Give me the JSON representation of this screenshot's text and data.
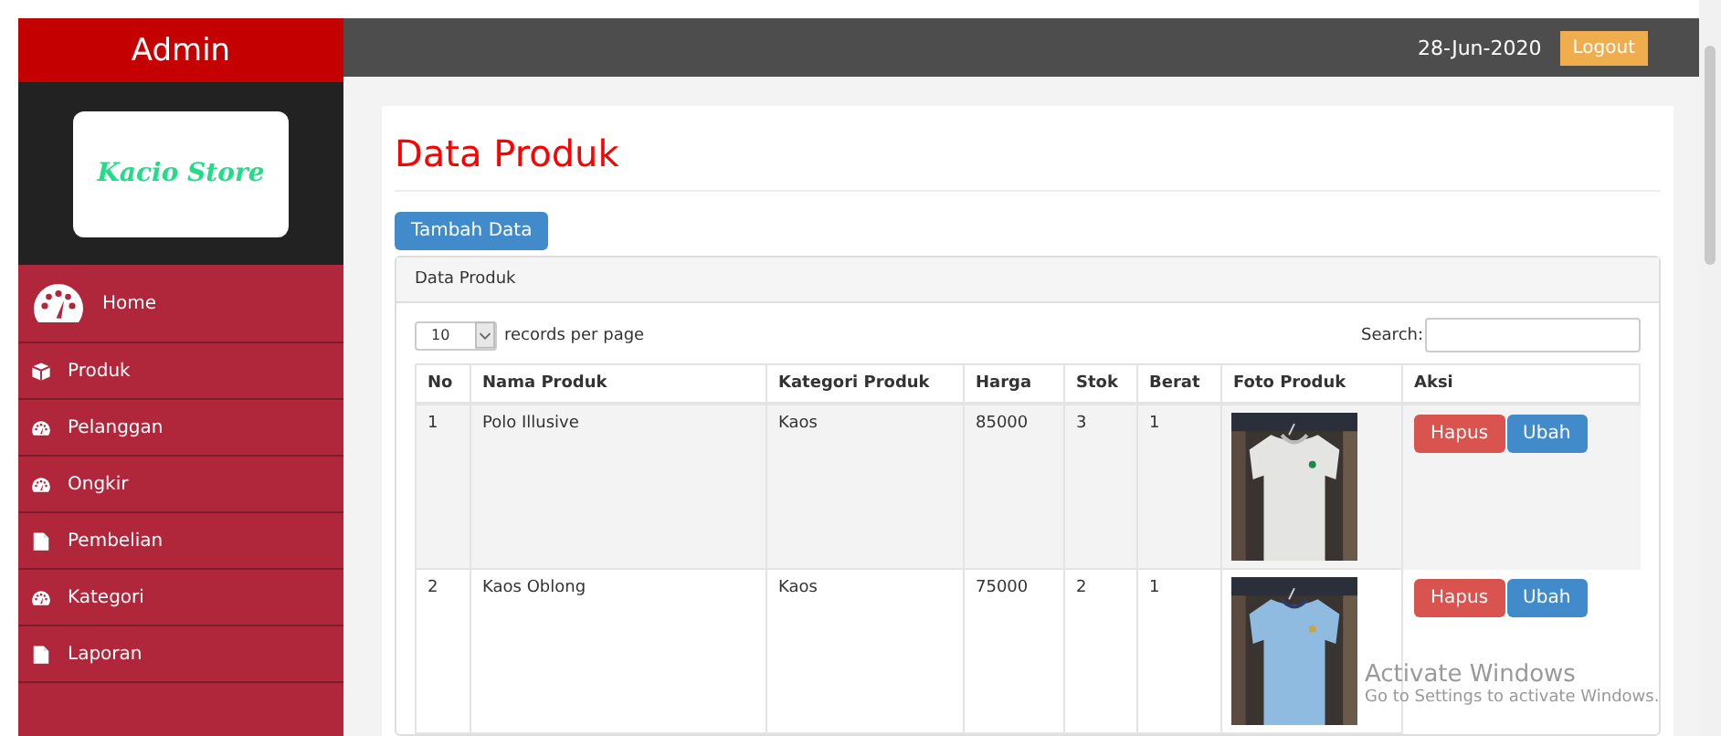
{
  "sidebar": {
    "title": "Admin",
    "logo": "Kacio Store",
    "items": [
      {
        "label": "Home",
        "kind": "gauge"
      },
      {
        "label": "Produk",
        "kind": "cube"
      },
      {
        "label": "Pelanggan",
        "kind": "gauge"
      },
      {
        "label": "Ongkir",
        "kind": "gauge"
      },
      {
        "label": "Pembelian",
        "kind": "file"
      },
      {
        "label": "Kategori",
        "kind": "gauge"
      },
      {
        "label": "Laporan",
        "kind": "file"
      }
    ]
  },
  "topbar": {
    "date": "28-Jun-2020",
    "logout": "Logout"
  },
  "page": {
    "title": "Data Produk",
    "add_button": "Tambah Data"
  },
  "panel": {
    "heading": "Data Produk",
    "page_size": "10",
    "page_size_label": "records per page",
    "search_label": "Search:",
    "columns": [
      "No",
      "Nama Produk",
      "Kategori Produk",
      "Harga",
      "Stok",
      "Berat",
      "Foto Produk",
      "Aksi"
    ],
    "rows": [
      {
        "no": "1",
        "name": "Polo Illusive",
        "category": "Kaos",
        "price": "85000",
        "stock": "3",
        "weight": "1",
        "actions": [
          "Hapus",
          "Ubah"
        ]
      },
      {
        "no": "2",
        "name": "Kaos Oblong",
        "category": "Kaos",
        "price": "75000",
        "stock": "2",
        "weight": "1",
        "actions": [
          "Hapus",
          "Ubah"
        ]
      }
    ]
  },
  "os_notice": {
    "title": "Activate Windows",
    "text": "Go to Settings to activate Windows."
  }
}
